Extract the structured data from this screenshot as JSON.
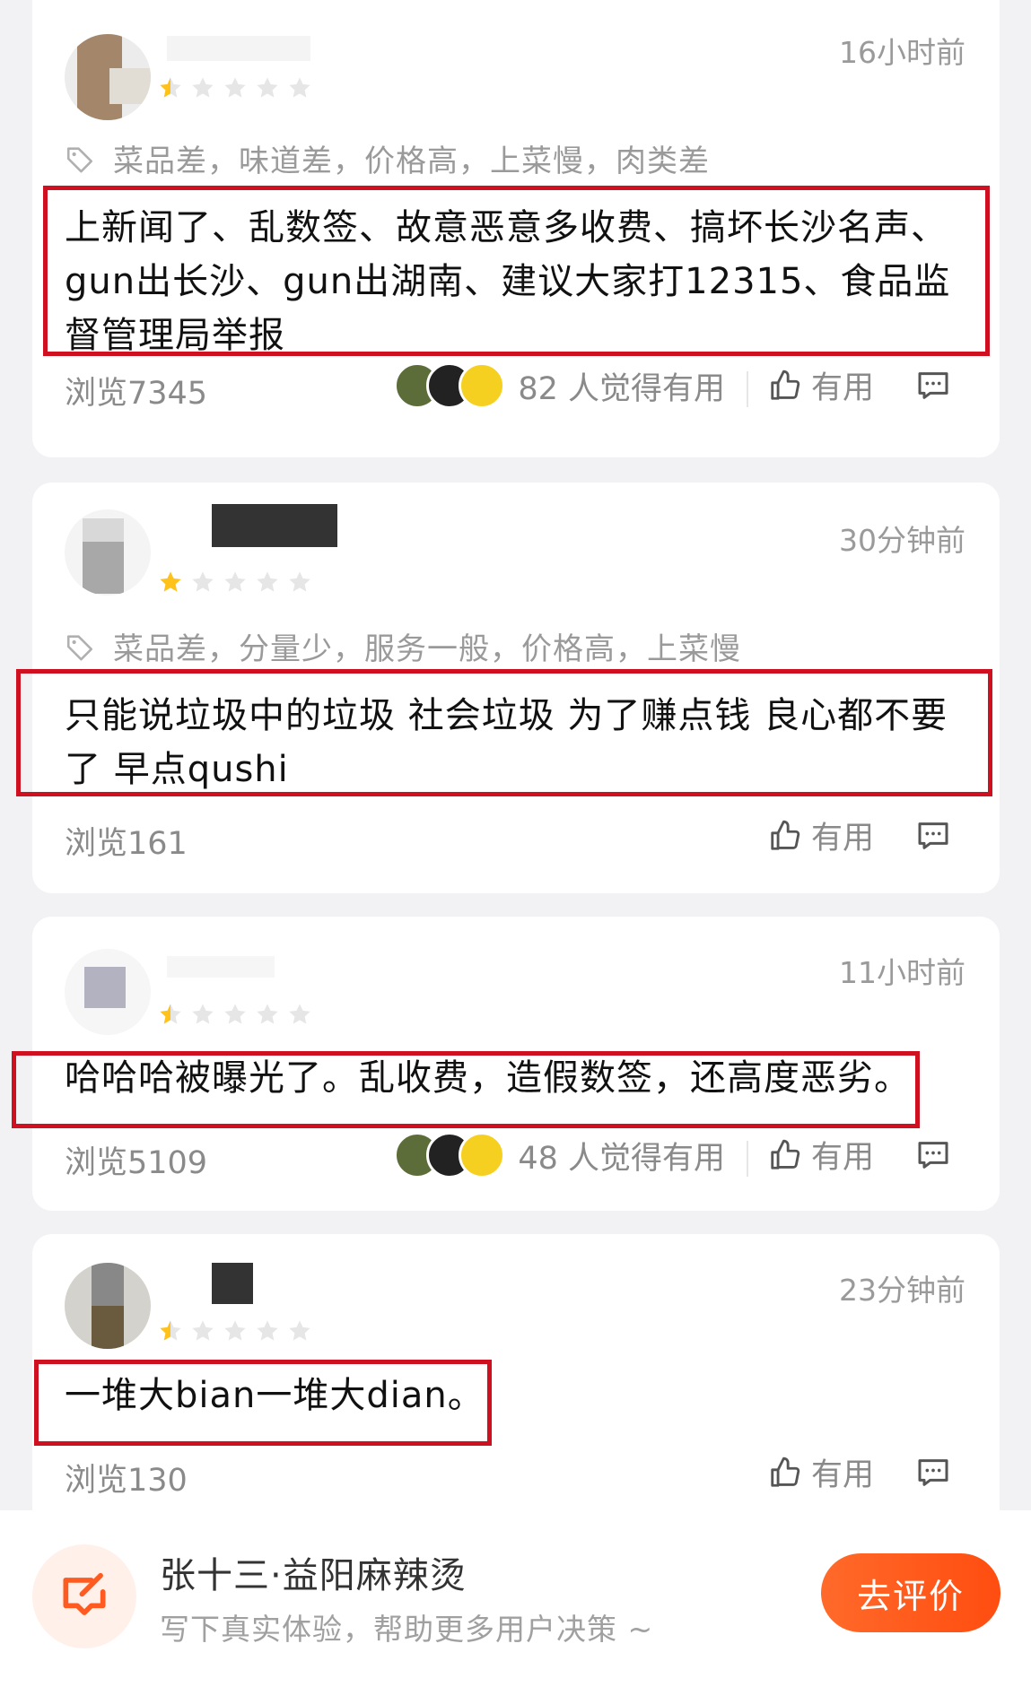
{
  "reviews": [
    {
      "time": "16小时前",
      "rating": "1",
      "tags": "菜品差，味道差，价格高，上菜慢，肉类差",
      "content": "上新闻了、乱数签、故意恶意多收费、搞坏长沙名声、gun出长沙、gun出湖南、建议大家打12315、食品监督管理局举报",
      "views": "浏览7345",
      "helpful": "82 人觉得有用",
      "useful_label": "有用"
    },
    {
      "time": "30分钟前",
      "rating": "1",
      "tags": "菜品差，分量少，服务一般，价格高，上菜慢",
      "content": "只能说垃圾中的垃圾 社会垃圾 为了赚点钱 良心都不要了 早点qushi",
      "views": "浏览161",
      "useful_label": "有用"
    },
    {
      "time": "11小时前",
      "rating": "1",
      "content": "哈哈哈被曝光了。乱收费，造假数签，还高度恶劣。",
      "views": "浏览5109",
      "helpful": "48 人觉得有用",
      "useful_label": "有用"
    },
    {
      "time": "23分钟前",
      "rating": "1",
      "content": "一堆大bian一堆大dian。",
      "views": "浏览130",
      "useful_label": "有用"
    }
  ],
  "bottom_bar": {
    "shop_name": "张十三·益阳麻辣烫",
    "hint": "写下真实体验，帮助更多用户决策 ~",
    "cta_label": "去评价"
  },
  "colors": {
    "accent": "#ff5a1f",
    "highlight_box": "#cf1020",
    "star_filled": "#ffc21a",
    "star_empty": "#e6e6e6"
  }
}
